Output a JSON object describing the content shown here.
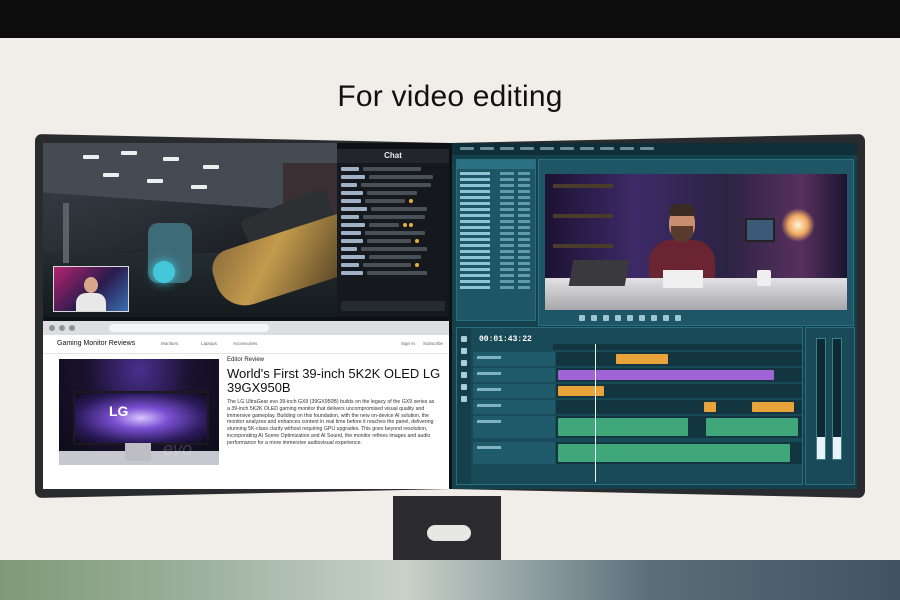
{
  "headline": "For video editing",
  "browser": {
    "site_name": "Gaming Monitor Reviews",
    "nav_links": [
      "Monitors",
      "Laptops",
      "Accessories"
    ],
    "nav_right": [
      "Sign In",
      "Subscribe"
    ],
    "section_label": "Editor Review",
    "article_title": "World's First 39-inch 5K2K OLED LG 39GX950B",
    "article_body": "The LG UltraGear evo 39-inch GX9 (39GX950B) builds on the legacy of the GX9 series as a 39-inch 5K2K OLED gaming monitor that delivers uncompromised visual quality and immersive gameplay. Building on this foundation, with the new on-device AI solution, the monitor analyzes and enhances content in real time before it reaches the panel, delivering stunning 5K-class clarity without requiring GPU upgrades. This goes beyond resolution, incorporating AI Scene Optimization and AI Sound, the monitor refines images and audio performance for a more immersive audiovisual experience.",
    "hero_logo": "LG",
    "hero_watermark": "evo"
  },
  "chat": {
    "title": "Chat"
  },
  "editor": {
    "timecode": "00:01:43:22"
  },
  "colors": {
    "editor_bg": "#15414d",
    "clip_orange": "#e8a33a",
    "clip_purple": "#a064d6",
    "clip_green": "#3fa77a"
  }
}
